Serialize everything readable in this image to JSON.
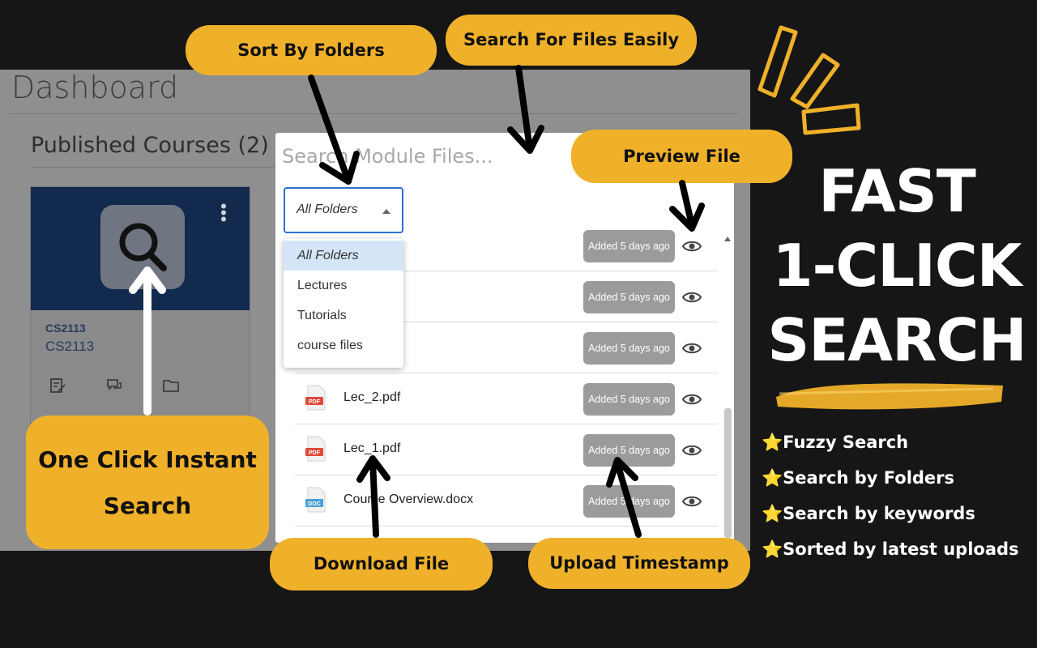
{
  "dashboard": {
    "title": "Dashboard",
    "published_heading": "Published Courses (2)",
    "card": {
      "code": "CS2113",
      "name": "CS2113",
      "kebab": "⋮"
    }
  },
  "modal": {
    "search_placeholder": "Search Module Files...",
    "folder_select": "All Folders",
    "dropdown_options": [
      "All Folders",
      "Lectures",
      "Tutorials",
      "course files"
    ],
    "files": [
      {
        "name": "",
        "type": "",
        "timestamp": "Added 5 days ago"
      },
      {
        "name": "",
        "type": "",
        "timestamp": "Added 5 days ago"
      },
      {
        "name": "",
        "type": "",
        "timestamp": "Added 5 days ago"
      },
      {
        "name": "Lec_2.pdf",
        "type": "PDF",
        "timestamp": "Added 5 days ago"
      },
      {
        "name": "Lec_1.pdf",
        "type": "PDF",
        "timestamp": "Added 5 days ago"
      },
      {
        "name": "Course Overview.docx",
        "type": "DOC",
        "timestamp": "Added 5 days ago"
      }
    ]
  },
  "callouts": {
    "sort": "Sort By Folders",
    "search": "Search For Files Easily",
    "preview": "Preview File",
    "download": "Download File",
    "upload": "Upload Timestamp",
    "one_click": "One Click Instant Search"
  },
  "headline": [
    "FAST",
    "1-CLICK",
    "SEARCH"
  ],
  "features": [
    "⭐Fuzzy Search",
    "⭐Search by Folders",
    "⭐Search by keywords",
    "⭐Sorted by latest uploads"
  ],
  "colors": {
    "accent": "#f0b12a",
    "background": "#161616",
    "card_header": "#132a4f",
    "select_border": "#2d6fd1",
    "badge": "#9b9b9b",
    "pdf": "#e04a3a",
    "doc": "#4a9fd8"
  }
}
